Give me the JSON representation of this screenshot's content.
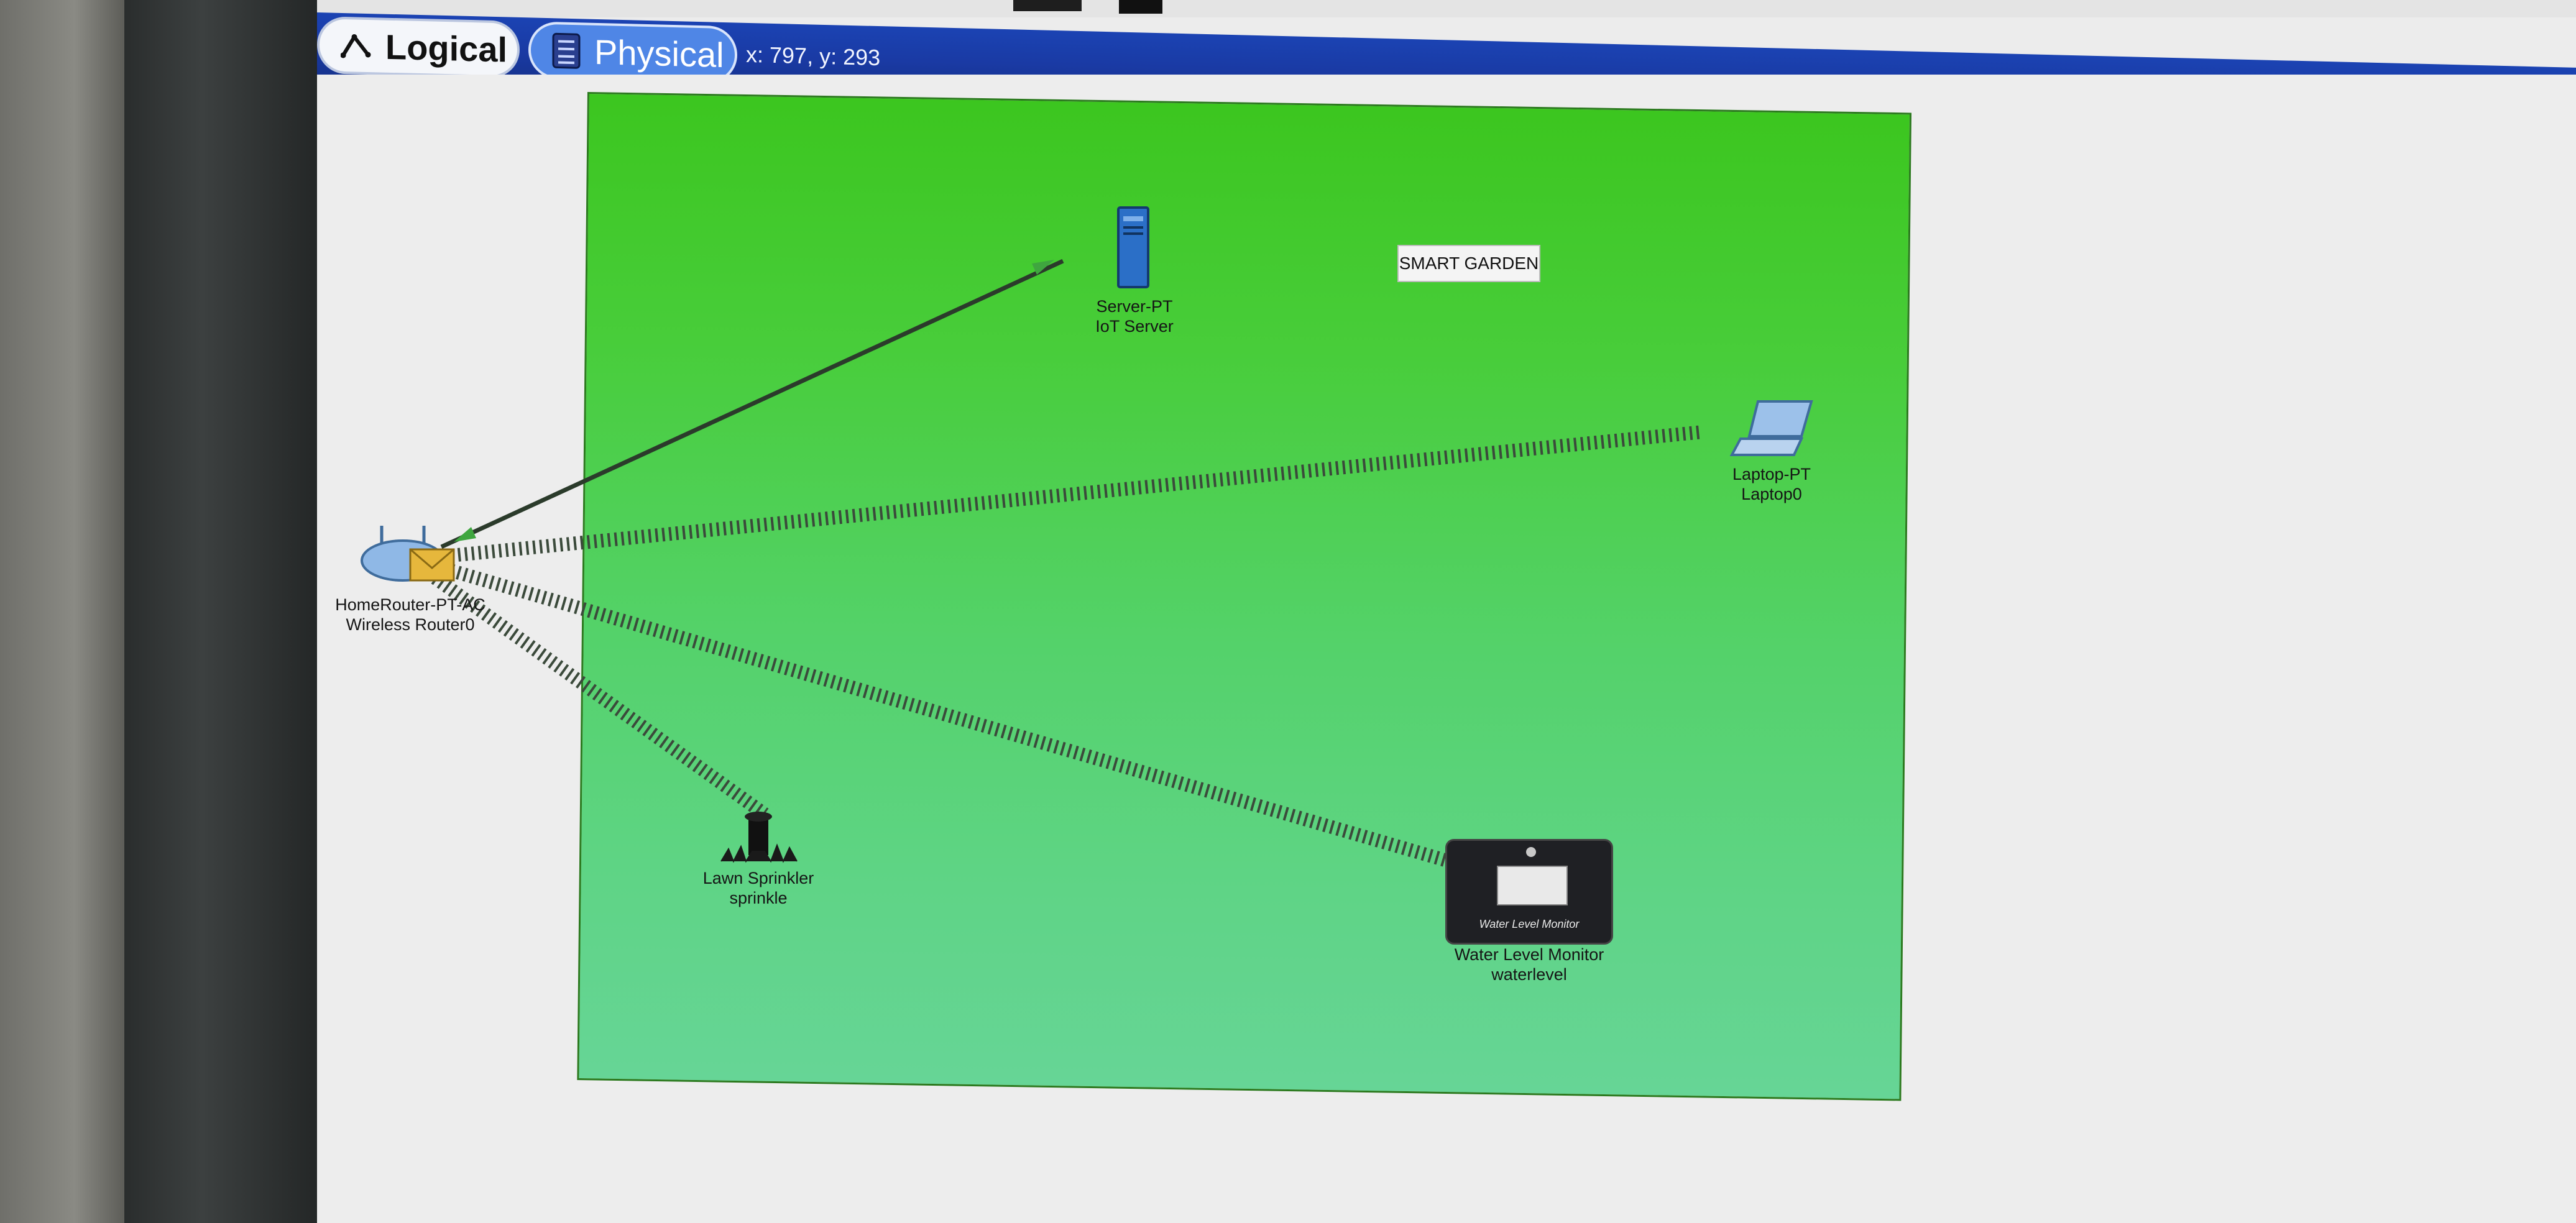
{
  "mode_bar": {
    "logical_tab": "Logical",
    "physical_tab": "Physical",
    "coordinates": "x: 797, y: 293"
  },
  "canvas": {
    "note": "SMART GARDEN"
  },
  "devices": [
    {
      "id": "server",
      "model": "Server-PT",
      "name": "IoT Server"
    },
    {
      "id": "laptop",
      "model": "Laptop-PT",
      "name": "Laptop0"
    },
    {
      "id": "router",
      "model": "HomeRouter-PT-AC",
      "name": "Wireless Router0"
    },
    {
      "id": "sprinkler",
      "model": "Lawn Sprinkler",
      "name": "sprinkle"
    },
    {
      "id": "water",
      "model": "Water Level Monitor",
      "name": "waterlevel",
      "panel_text": "Water Level Monitor"
    }
  ],
  "colors": {
    "mode_bar": "#1a3aa4",
    "garden_top": "#3cc61f",
    "garden_bottom": "#66d596",
    "wired_link": "#2b3b2b",
    "link_arrow": "#3fa63f"
  },
  "icons": [
    "logical-icon",
    "physical-icon",
    "server-icon",
    "laptop-icon",
    "router-icon",
    "sprinkler-icon",
    "water-level-monitor-icon"
  ]
}
